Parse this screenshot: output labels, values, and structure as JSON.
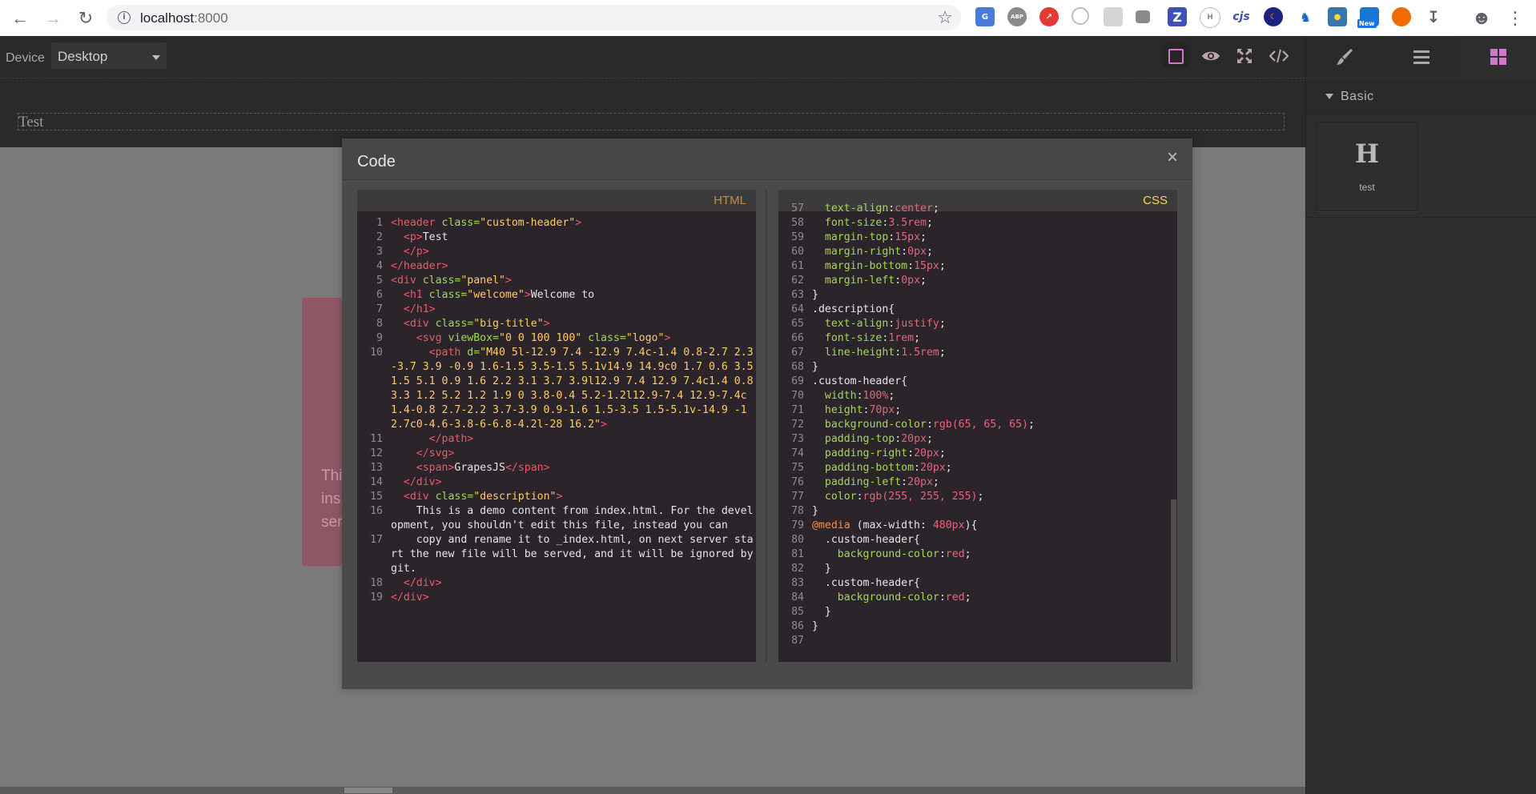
{
  "browser": {
    "url_host": "localhost",
    "url_port": ":8000",
    "extensions": [
      "G",
      "ABP",
      "",
      "",
      "",
      "",
      "Z",
      "",
      "cjs",
      "",
      "",
      "",
      "",
      "",
      ""
    ],
    "new_badge": "New"
  },
  "topbar": {
    "device_label": "Device",
    "device_value": "Desktop"
  },
  "canvas": {
    "header_text": "Test",
    "panel_fragments": [
      "Thi",
      "ins",
      "ser"
    ]
  },
  "right_panel": {
    "category": "Basic",
    "block_icon": "H",
    "block_label": "test"
  },
  "modal": {
    "title": "Code",
    "close": "×",
    "html_label": "HTML",
    "css_label": "CSS"
  },
  "html_lines": [
    {
      "n": "1"
    },
    {
      "n": "2"
    },
    {
      "n": "3"
    },
    {
      "n": "4"
    },
    {
      "n": "5"
    },
    {
      "n": "6"
    },
    {
      "n": "7"
    },
    {
      "n": "8"
    },
    {
      "n": "9"
    },
    {
      "n": "10"
    },
    {
      "n": "11"
    },
    {
      "n": "12"
    },
    {
      "n": "13"
    },
    {
      "n": "14"
    },
    {
      "n": "15"
    },
    {
      "n": "16"
    },
    {
      "n": "17"
    },
    {
      "n": "18"
    },
    {
      "n": "19"
    }
  ],
  "code": {
    "html": {
      "l1_tag": "<header",
      "l1_attr": " class=",
      "l1_str": "\"custom-header\"",
      "l1_end": ">",
      "l2_tag": "  <p>",
      "l2_txt": "Test",
      "l3_tag": "  </p>",
      "l4_tag": "</header>",
      "l5_tag": "<div",
      "l5_attr": " class=",
      "l5_str": "\"panel\"",
      "l5_end": ">",
      "l6_tag": "  <h1",
      "l6_attr": " class=",
      "l6_str": "\"welcome\"",
      "l6_end": ">",
      "l6_txt": "Welcome to",
      "l7_tag": "  </h1>",
      "l8_tag": "  <div",
      "l8_attr": " class=",
      "l8_str": "\"big-title\"",
      "l8_end": ">",
      "l9_tag": "    <svg",
      "l9_attr1": " viewBox=",
      "l9_str1": "\"0 0 100 100\"",
      "l9_attr2": " class=",
      "l9_str2": "\"logo\"",
      "l9_end": ">",
      "l10_tag": "      <path",
      "l10_attr": " d=",
      "l10_str": "\"M40 5l-12.9 7.4 -12.9 7.4c-1.4 0.8-2.7 2.3-3.7 3.9 -0.9 1.6-1.5 3.5-1.5 5.1v14.9 14.9c0 1.7 0.6 3.5 1.5 5.1 0.9 1.6 2.2 3.1 3.7 3.9l12.9 7.4 12.9 7.4c1.4 0.8 3.3 1.2 5.2 1.2 1.9 0 3.8-0.4 5.2-1.2l12.9-7.4 12.9-7.4c1.4-0.8 2.7-2.2 3.7-3.9 0.9-1.6 1.5-3.5 1.5-5.1v-14.9 -12.7c0-4.6-3.8-6-6.8-4.2l-28 16.2\"",
      "l10_end": ">",
      "l11_tag": "      </path>",
      "l12_tag": "    </svg>",
      "l13_tag": "    <span>",
      "l13_txt": "GrapesJS",
      "l13_end": "</span>",
      "l14_tag": "  </div>",
      "l15_tag": "  <div",
      "l15_attr": " class=",
      "l15_str": "\"description\"",
      "l15_end": ">",
      "l16_txt": "    This is a demo content from index.html. For the development, you shouldn't edit this file, instead you can",
      "l17_txt": "    copy and rename it to _index.html, on next server start the new file will be served, and it will be ignored by git.",
      "l18_tag": "  </div>",
      "l19_tag": "</div>"
    },
    "css": [
      {
        "n": "57",
        "sel": "",
        "prop": "  text-align",
        "val": "center",
        "suffix": ";"
      },
      {
        "n": "58",
        "sel": "",
        "prop": "  font-size",
        "val": "3.5rem",
        "suffix": ";"
      },
      {
        "n": "59",
        "sel": "",
        "prop": "  margin-top",
        "val": "15px",
        "suffix": ";"
      },
      {
        "n": "60",
        "sel": "",
        "prop": "  margin-right",
        "val": "0px",
        "suffix": ";"
      },
      {
        "n": "61",
        "sel": "",
        "prop": "  margin-bottom",
        "val": "15px",
        "suffix": ";"
      },
      {
        "n": "62",
        "sel": "",
        "prop": "  margin-left",
        "val": "0px",
        "suffix": ";"
      },
      {
        "n": "63",
        "sel": "}",
        "prop": "",
        "val": "",
        "suffix": ""
      },
      {
        "n": "64",
        "sel": ".description{",
        "prop": "",
        "val": "",
        "suffix": ""
      },
      {
        "n": "65",
        "sel": "",
        "prop": "  text-align",
        "val": "justify",
        "suffix": ";"
      },
      {
        "n": "66",
        "sel": "",
        "prop": "  font-size",
        "val": "1rem",
        "suffix": ";"
      },
      {
        "n": "67",
        "sel": "",
        "prop": "  line-height",
        "val": "1.5rem",
        "suffix": ";"
      },
      {
        "n": "68",
        "sel": "}",
        "prop": "",
        "val": "",
        "suffix": ""
      },
      {
        "n": "69",
        "sel": ".custom-header{",
        "prop": "",
        "val": "",
        "suffix": ""
      },
      {
        "n": "70",
        "sel": "",
        "prop": "  width",
        "val": "100%",
        "suffix": ";"
      },
      {
        "n": "71",
        "sel": "",
        "prop": "  height",
        "val": "70px",
        "suffix": ";"
      },
      {
        "n": "72",
        "sel": "",
        "prop": "  background-color",
        "val": "rgb(65, 65, 65)",
        "suffix": ";"
      },
      {
        "n": "73",
        "sel": "",
        "prop": "  padding-top",
        "val": "20px",
        "suffix": ";"
      },
      {
        "n": "74",
        "sel": "",
        "prop": "  padding-right",
        "val": "20px",
        "suffix": ";"
      },
      {
        "n": "75",
        "sel": "",
        "prop": "  padding-bottom",
        "val": "20px",
        "suffix": ";"
      },
      {
        "n": "76",
        "sel": "",
        "prop": "  padding-left",
        "val": "20px",
        "suffix": ";"
      },
      {
        "n": "77",
        "sel": "",
        "prop": "  color",
        "val": "rgb(255, 255, 255)",
        "suffix": ";"
      },
      {
        "n": "78",
        "sel": "}",
        "prop": "",
        "val": "",
        "suffix": ""
      },
      {
        "n": "79",
        "sel": "",
        "prop": "",
        "val": "",
        "suffix": "",
        "media": "@media",
        "media_rest": " (max-width: ",
        "media_num": "480px",
        "media_end": "){"
      },
      {
        "n": "80",
        "sel": "  .custom-header{",
        "prop": "",
        "val": "",
        "suffix": ""
      },
      {
        "n": "81",
        "sel": "",
        "prop": "    background-color",
        "val": "red",
        "suffix": ";"
      },
      {
        "n": "82",
        "sel": "  }",
        "prop": "",
        "val": "",
        "suffix": ""
      },
      {
        "n": "83",
        "sel": "  .custom-header{",
        "prop": "",
        "val": "",
        "suffix": ""
      },
      {
        "n": "84",
        "sel": "",
        "prop": "    background-color",
        "val": "red",
        "suffix": ";"
      },
      {
        "n": "85",
        "sel": "  }",
        "prop": "",
        "val": "",
        "suffix": ""
      },
      {
        "n": "86",
        "sel": "}",
        "prop": "",
        "val": "",
        "suffix": ""
      },
      {
        "n": "87",
        "sel": "",
        "prop": "",
        "val": "",
        "suffix": ""
      }
    ]
  },
  "colors": {
    "accent": "#d278c9",
    "tag": "#f4546a",
    "attr": "#a5d94b",
    "string": "#ffcc66",
    "number": "#e5657a"
  }
}
